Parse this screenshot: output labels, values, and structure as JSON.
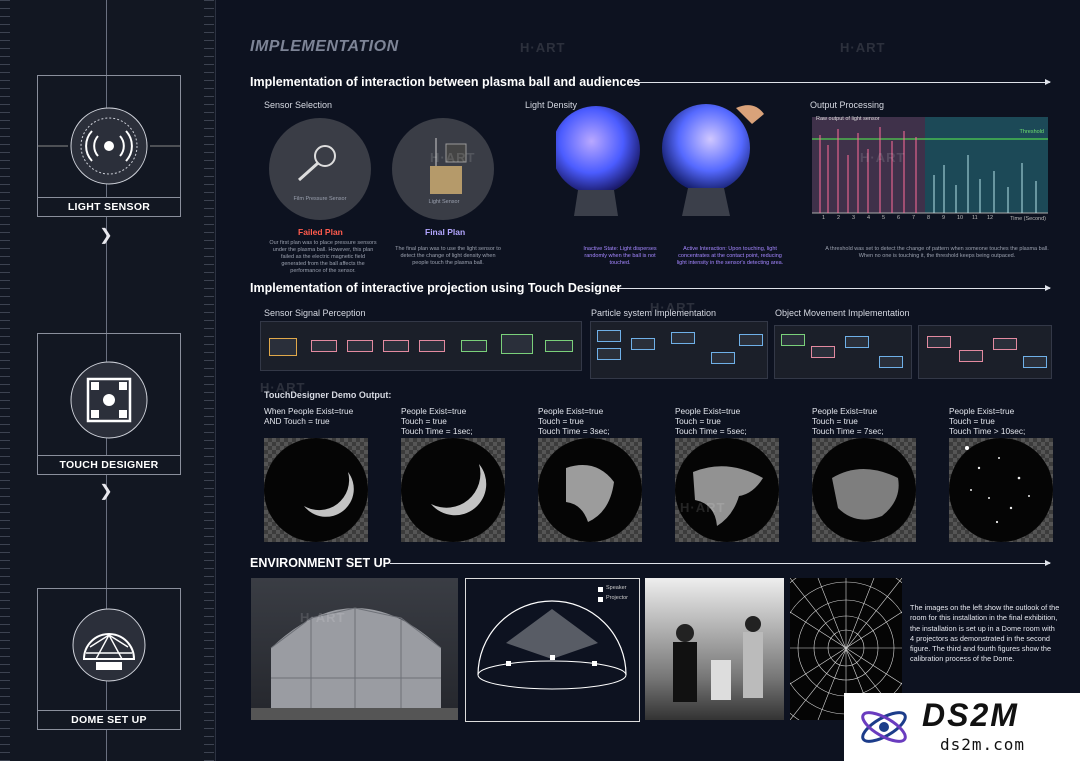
{
  "sidebar": {
    "modules": [
      {
        "label": "LIGHT SENSOR",
        "icon": "light-sensor-icon"
      },
      {
        "label": "TOUCH DESIGNER",
        "icon": "touch-designer-icon"
      },
      {
        "label": "DOME SET UP",
        "icon": "dome-icon"
      }
    ]
  },
  "main": {
    "title": "IMPLEMENTATION",
    "section1": {
      "heading": "Implementation of interaction between plasma ball and audiences",
      "sensor_selection": {
        "label": "Sensor Selection",
        "failed_caption": "Film Pressure Sensor",
        "final_caption": "Light Sensor",
        "failed_title": "Failed Plan",
        "final_title": "Final Plan",
        "failed_desc": "Our first plan was to place pressure sensors under the plasma ball. However, this plan failed as the electric magnetic field generated from the ball affects the performance of the sensor.",
        "final_desc": "The final plan was to use the light sensor to detect the change of light density when people touch the plasma ball."
      },
      "light_density": {
        "label": "Light Density",
        "inactive_desc": "Inactive State: Light disperses randomly when the ball is not touched.",
        "active_desc": "Active Interaction: Upon touching, light concentrates at the contact point, reducing light intensity in the sensor's detecting area."
      },
      "output_processing": {
        "label": "Output Processing",
        "legend": "Raw output of light sensor",
        "threshold": "Threshold",
        "xlabel": "Time (Second)",
        "ticks": [
          "1",
          "2",
          "3",
          "4",
          "5",
          "6",
          "7",
          "8",
          "9",
          "10",
          "11",
          "12"
        ],
        "desc": "A threshold was set to detect the change of pattern when someone touches the plasma ball. When no one is touching it, the threshold keeps being outpaced."
      }
    },
    "section2": {
      "heading": "Implementation of interactive projection using Touch Designer",
      "panels": [
        "Sensor Signal Perception",
        "Particle system Implementation",
        "Object Movement Implementation"
      ],
      "demo_title": "TouchDesigner Demo Output:",
      "demos": [
        {
          "l1": "When People Exist=true",
          "l2": "AND  Touch = true",
          "l3": ""
        },
        {
          "l1": "People Exist=true",
          "l2": "Touch = true",
          "l3": "Touch Time = 1sec;"
        },
        {
          "l1": "People Exist=true",
          "l2": "Touch = true",
          "l3": "Touch Time = 3sec;"
        },
        {
          "l1": "People Exist=true",
          "l2": "Touch = true",
          "l3": "Touch Time = 5sec;"
        },
        {
          "l1": "People Exist=true",
          "l2": "Touch = true",
          "l3": "Touch Time = 7sec;"
        },
        {
          "l1": "People Exist=true",
          "l2": "Touch = true",
          "l3": "Touch Time > 10sec;"
        }
      ]
    },
    "section3": {
      "heading": "ENVIRONMENT SET UP",
      "legend_speaker": "Speaker",
      "legend_projector": "Projector",
      "desc": "The images on the left show the outlook of the room for this installation in the final exhibition, the installation is set up in a Dome room with 4 projectors as demonstrated in the second figure. The third and fourth figures show the calibration process of the Dome."
    }
  },
  "watermark": "H·ART",
  "logo": {
    "name": "DS2M",
    "url": "ds2m.com"
  }
}
